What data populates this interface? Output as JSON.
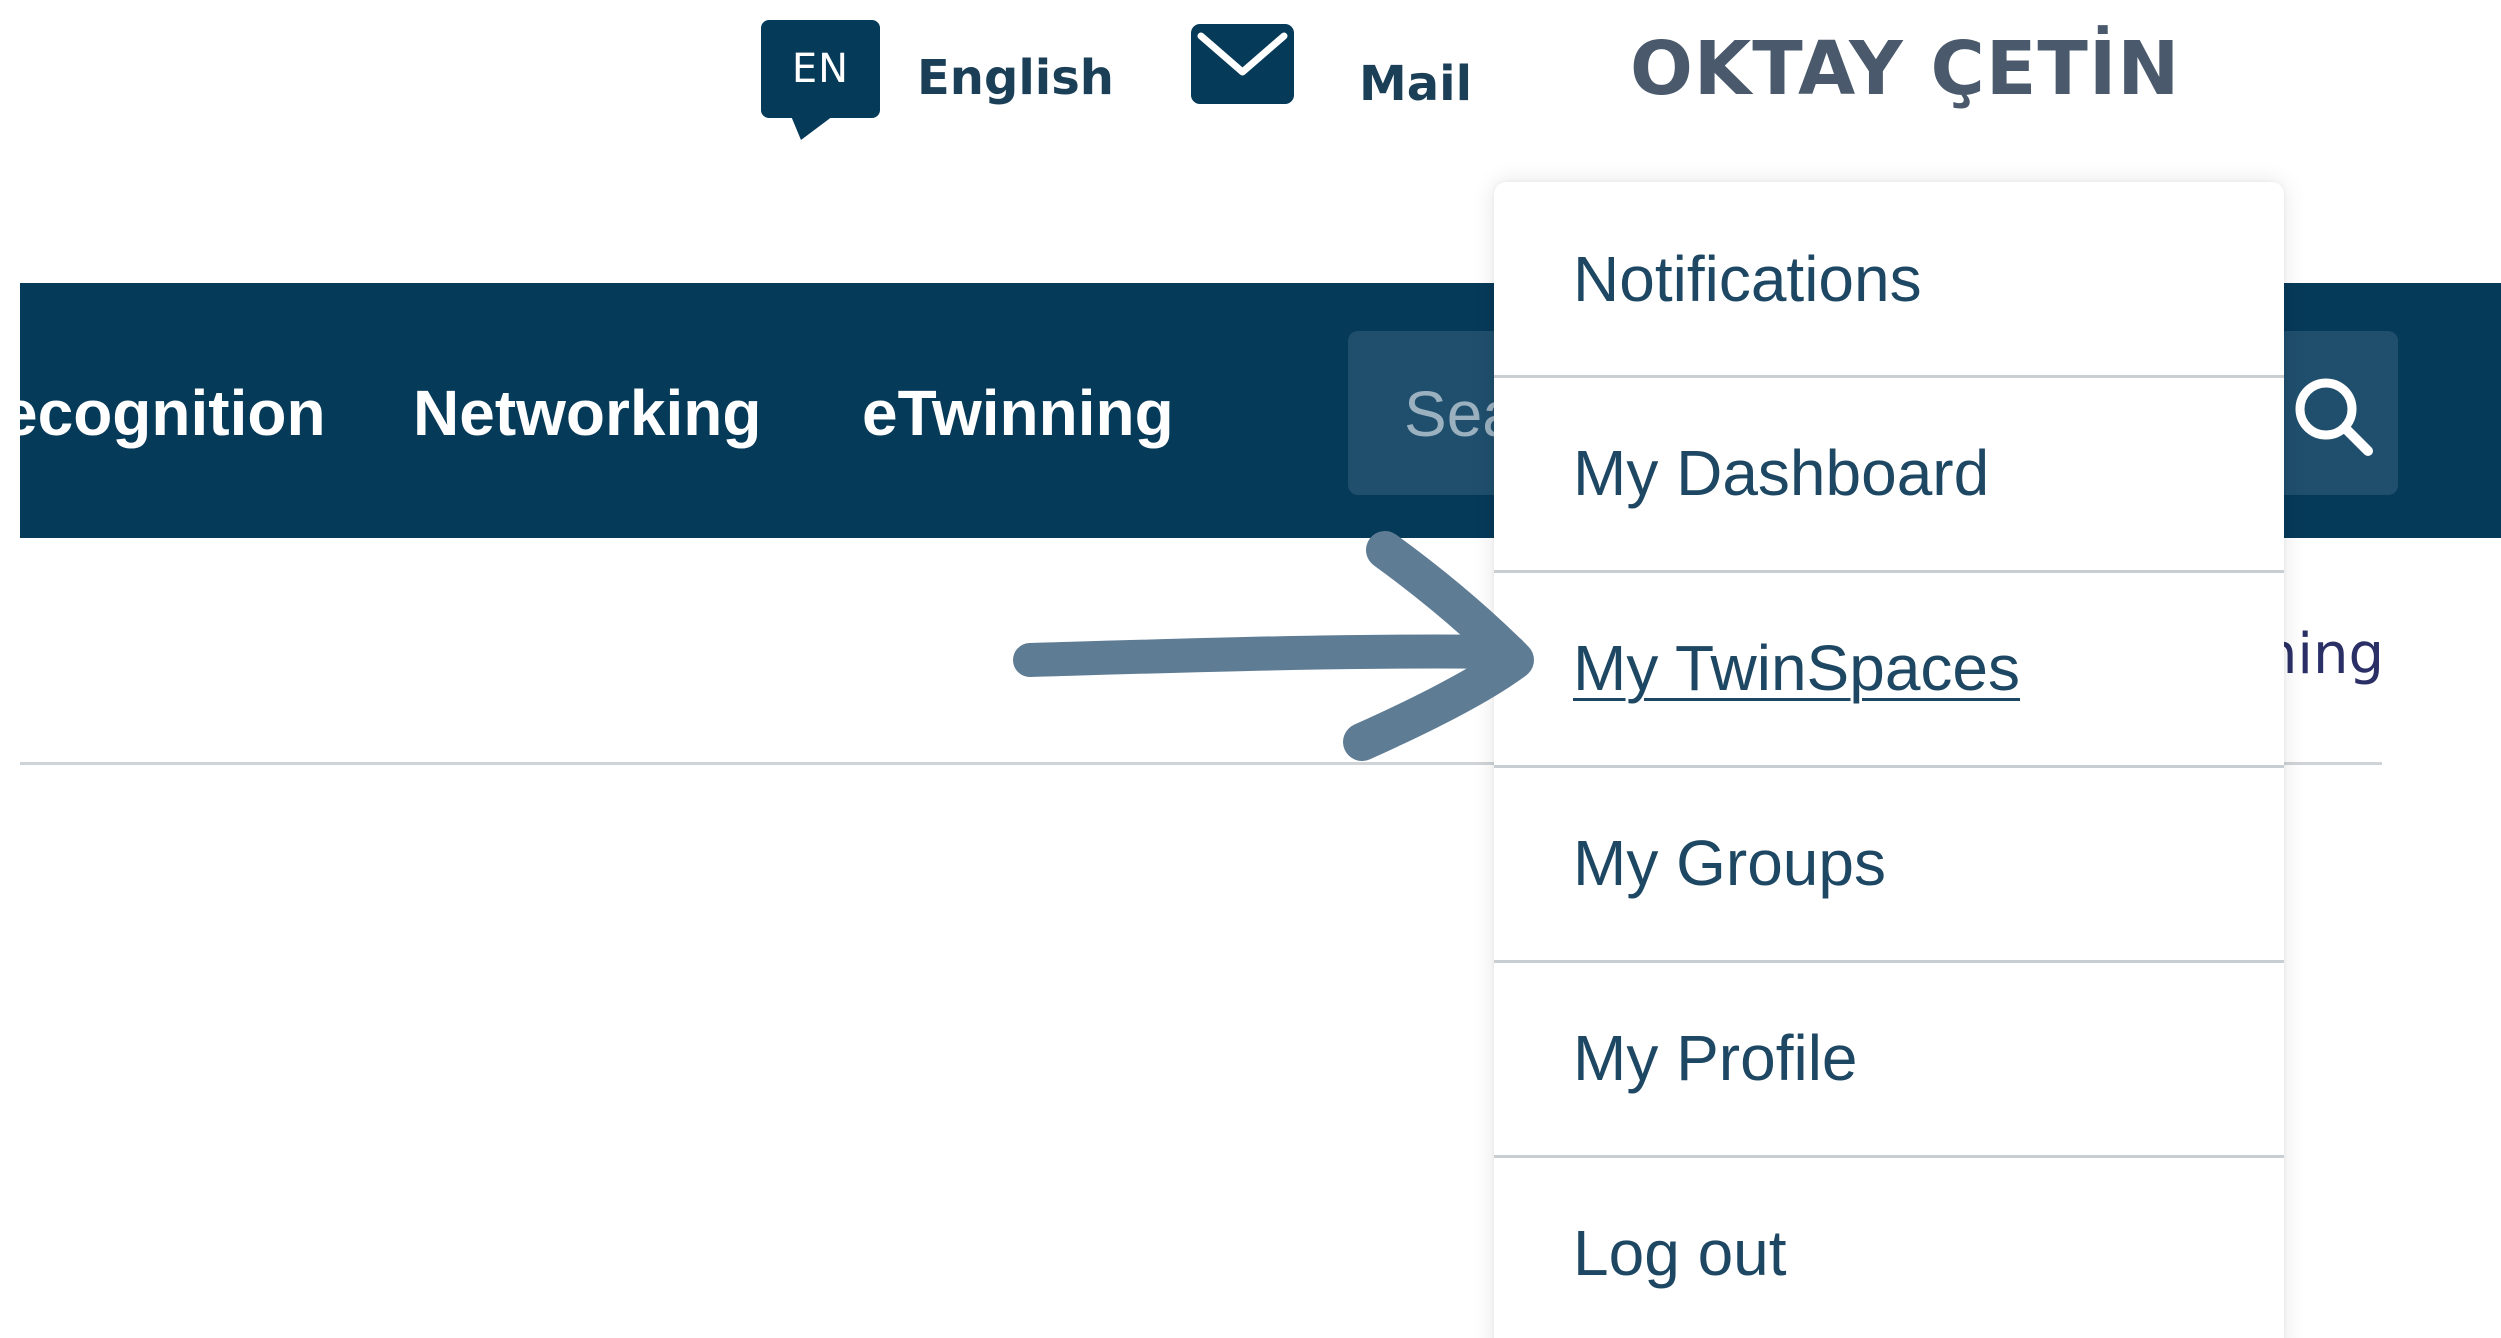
{
  "header": {
    "language": {
      "code": "EN",
      "label": "English"
    },
    "mail": {
      "label": "Mail",
      "icon": "envelope-icon"
    },
    "user_name": "OKTAY ÇETİN"
  },
  "navbar": {
    "items": [
      {
        "label": "ecognition"
      },
      {
        "label": "Networking"
      },
      {
        "label": "eTwinning"
      }
    ],
    "search": {
      "placeholder": "Search",
      "icon": "search-icon"
    }
  },
  "subnav": {
    "partial_link": "ning"
  },
  "user_menu": {
    "items": [
      {
        "label": "Notifications"
      },
      {
        "label": "My Dashboard"
      },
      {
        "label": "My TwinSpaces",
        "active": true
      },
      {
        "label": "My Groups"
      },
      {
        "label": "My Profile"
      },
      {
        "label": "Log out"
      }
    ]
  },
  "annotation": {
    "icon": "arrow-right-icon",
    "color": "#5f7c95"
  },
  "colors": {
    "brand_navy": "#063a59",
    "search_bg": "#1f4f6d",
    "menu_text": "#1d4763",
    "username_text": "#4a5a6c"
  }
}
